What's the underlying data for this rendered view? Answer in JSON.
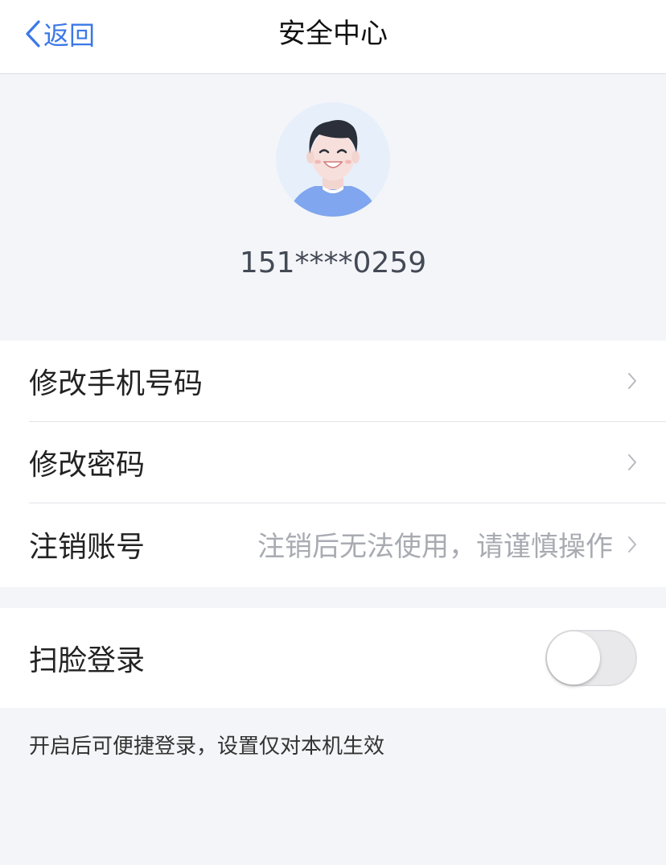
{
  "nav": {
    "back_label": "返回",
    "title": "安全中心"
  },
  "profile": {
    "phone": "151****0259"
  },
  "account_rows": [
    {
      "label": "修改手机号码",
      "hint": ""
    },
    {
      "label": "修改密码",
      "hint": ""
    },
    {
      "label": "注销账号",
      "hint": "注销后无法使用，请谨慎操作"
    }
  ],
  "face_login": {
    "label": "扫脸登录",
    "enabled": false,
    "note": "开启后可便捷登录，设置仅对本机生效"
  },
  "colors": {
    "accent": "#3b78e7",
    "background": "#f4f5f9",
    "avatar_shirt": "#7fa6ee"
  }
}
